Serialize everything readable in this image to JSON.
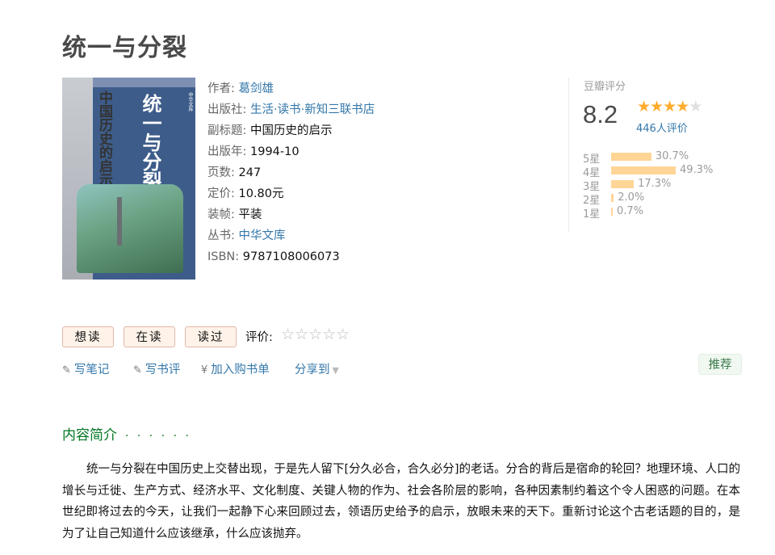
{
  "book": {
    "title": "统一与分裂",
    "cover": {
      "title_vertical": "统一与分裂",
      "subtitle_vertical": "中国历史的启示",
      "series_mark": "中华文库"
    },
    "info": {
      "author_label": "作者:",
      "author": "葛剑雄",
      "publisher_label": "出版社:",
      "publisher": "生活·读书·新知三联书店",
      "subtitle_label": "副标题:",
      "subtitle": "中国历史的启示",
      "year_label": "出版年:",
      "year": "1994-10",
      "pages_label": "页数:",
      "pages": "247",
      "price_label": "定价:",
      "price": "10.80元",
      "binding_label": "装帧:",
      "binding": "平装",
      "series_label": "丛书:",
      "series": "中华文库",
      "isbn_label": "ISBN:",
      "isbn": "9787108006073"
    }
  },
  "rating": {
    "label": "豆瓣评分",
    "score": "8.2",
    "stars_value": 4,
    "stars_max": 5,
    "votes": "446人评价",
    "distribution": [
      {
        "label": "5星",
        "percent_text": "30.7%",
        "value": 30.7
      },
      {
        "label": "4星",
        "percent_text": "49.3%",
        "value": 49.3
      },
      {
        "label": "3星",
        "percent_text": "17.3%",
        "value": 17.3
      },
      {
        "label": "2星",
        "percent_text": "2.0%",
        "value": 2.0
      },
      {
        "label": "1星",
        "percent_text": "0.7%",
        "value": 0.7
      }
    ]
  },
  "actions": {
    "want": "想读",
    "reading": "在读",
    "read": "读过",
    "rate_label": "评价:",
    "rate_stars": "☆☆☆☆☆"
  },
  "ops": {
    "note": "写笔记",
    "review": "写书评",
    "cart": "加入购书单",
    "share": "分享到",
    "yen": "¥"
  },
  "recommend": "推荐",
  "intro": {
    "heading": "内容简介",
    "dots": "· · · · · ·",
    "text": "统一与分裂在中国历史上交替出现，于是先人留下[分久必合，合久必分]的老话。分合的背后是宿命的轮回？地理环境、人口的增长与迁徙、生产方式、经济水平、文化制度、关键人物的作为、社会各阶层的影响，各种因素制约着这个令人困惑的问题。在本世纪即将过去的今天，让我们一起静下心来回顾过去，领语历史给予的启示，放眼未来的天下。重新讨论这个古老话题的目的，是为了让自己知道什么应该继承，什么应该抛弃。"
  },
  "colors": {
    "link": "#3377aa",
    "star_on": "#ffac2d",
    "bar": "#ffd596",
    "section_green": "#007722"
  }
}
